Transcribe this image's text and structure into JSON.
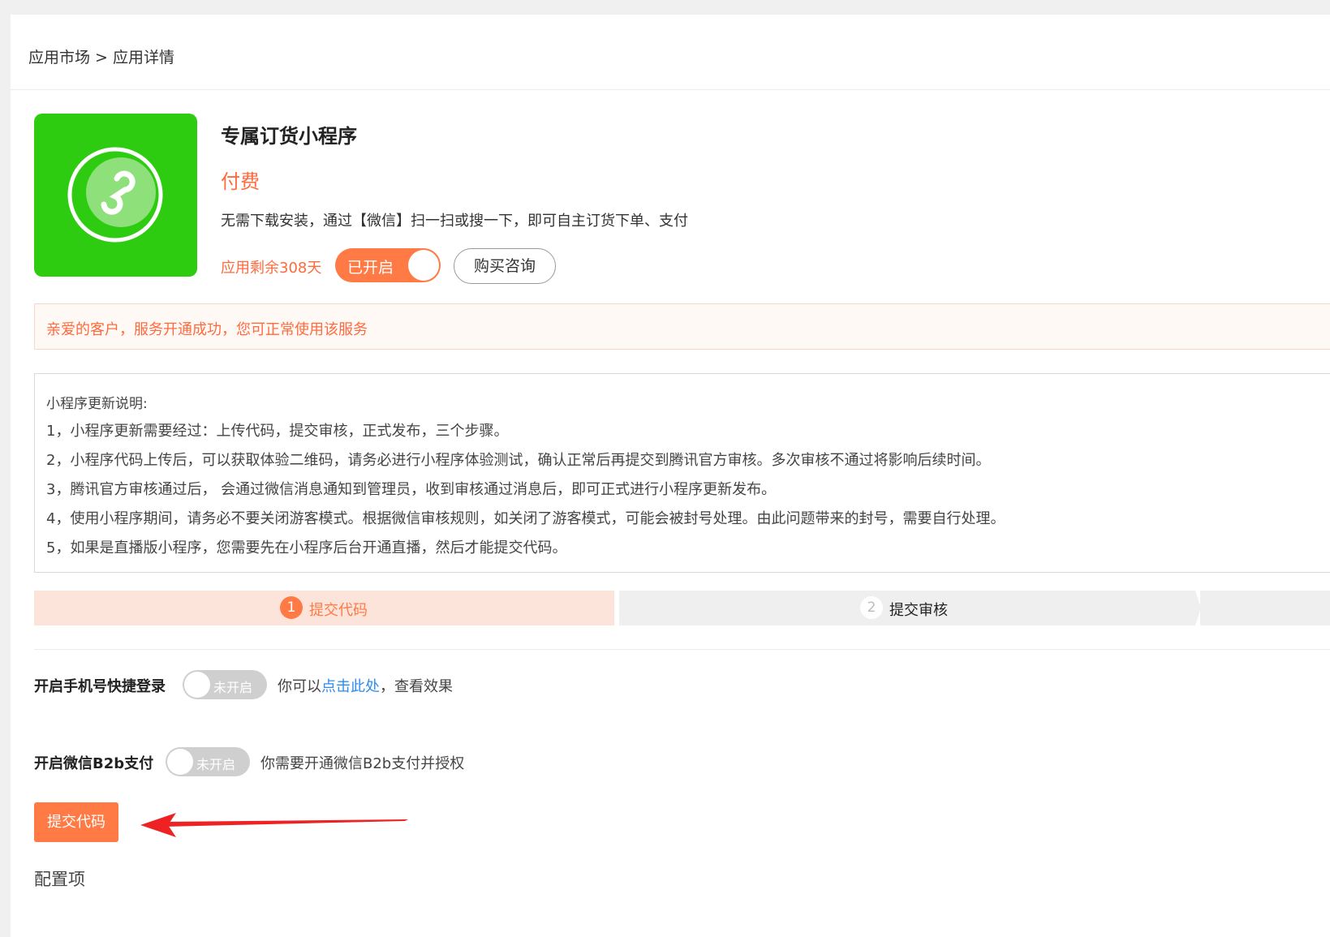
{
  "breadcrumb": {
    "parent": "应用市场",
    "separator": ">",
    "current": "应用详情"
  },
  "app": {
    "name": "专属订货小程序",
    "price": "付费",
    "description": "无需下载安装，通过【微信】扫一扫或搜一下，即可自主订货下单、支付",
    "remaining": "应用剩余308天",
    "status_label": "已开启",
    "consult_label": "购买咨询",
    "icon": "mini-program-icon",
    "icon_bg": "#2ecc10"
  },
  "notice": "亲爱的客户，服务开通成功，您可正常使用该服务",
  "explain": {
    "title": "小程序更新说明:",
    "lines": [
      "1，小程序更新需要经过：上传代码，提交审核，正式发布，三个步骤。",
      "2，小程序代码上传后，可以获取体验二维码，请务必进行小程序体验测试，确认正常后再提交到腾讯官方审核。多次审核不通过将影响后续时间。",
      "3，腾讯官方审核通过后， 会通过微信消息通知到管理员，收到审核通过消息后，即可正式进行小程序更新发布。",
      "4，使用小程序期间，请务必不要关闭游客模式。根据微信审核规则，如关闭了游客模式，可能会被封号处理。由此问题带来的封号，需要自行处理。",
      "5，如果是直播版小程序，您需要先在小程序后台开通直播，然后才能提交代码。"
    ]
  },
  "steps": [
    {
      "num": "1",
      "label": "提交代码",
      "active": true
    },
    {
      "num": "2",
      "label": "提交审核",
      "active": false
    }
  ],
  "features": {
    "phone_login": {
      "label": "开启手机号快捷登录",
      "toggle": "未开启",
      "note_prefix": "你可以",
      "note_link": "点击此处",
      "note_suffix": "，查看效果"
    },
    "b2b_pay": {
      "label": "开启微信B2b支付",
      "toggle": "未开启",
      "note": "你需要开通微信B2b支付并授权"
    }
  },
  "submit_label": "提交代码",
  "config_title": "配置项",
  "colors": {
    "accent": "#ff7a45",
    "notice_text": "#ff6a3d",
    "link": "#2d8cf0",
    "arrow": "#ee2222"
  }
}
